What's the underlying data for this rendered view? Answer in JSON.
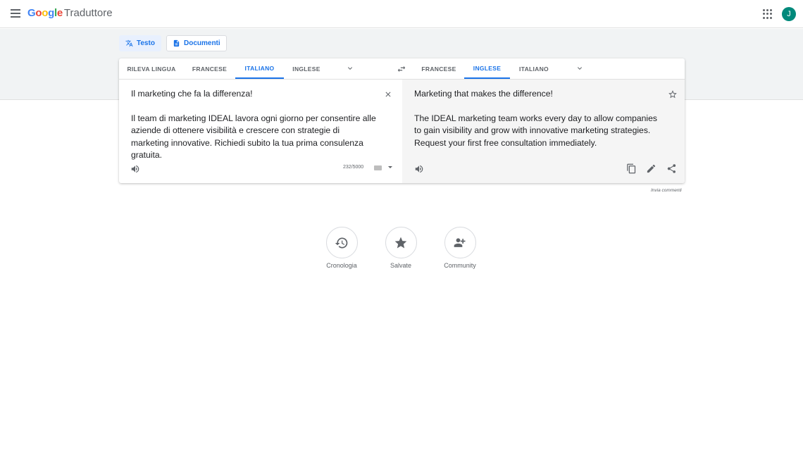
{
  "header": {
    "logo_text": "Google",
    "product_name": "Traduttore",
    "avatar_initial": "J",
    "icons": [
      "menu-icon",
      "apps-grid-icon"
    ]
  },
  "modes": [
    {
      "label": "Testo",
      "icon": "translate-icon",
      "active": true
    },
    {
      "label": "Documenti",
      "icon": "document-icon",
      "active": false
    }
  ],
  "source_languages": [
    "RILEVA LINGUA",
    "FRANCESE",
    "ITALIANO",
    "INGLESE"
  ],
  "source_active": "ITALIANO",
  "target_languages": [
    "FRANCESE",
    "INGLESE",
    "ITALIANO"
  ],
  "target_active": "INGLESE",
  "source": {
    "line1": "Il marketing che fa la differenza!",
    "line2": "Il team di marketing IDEAL lavora ogni giorno per consentire alle aziende di ottenere visibilità e crescere con strategie di marketing innovative. Richiedi subito la tua prima consulenza gratuita.",
    "char_count": "232/5000"
  },
  "target": {
    "line1": "Marketing that makes the difference!",
    "line2": "The IDEAL marketing team works every day to allow companies to gain visibility and grow with innovative marketing strategies. Request your first free consultation immediately."
  },
  "feedback_label": "Invia commenti",
  "quick_links": [
    {
      "label": "Cronologia",
      "icon": "history-icon"
    },
    {
      "label": "Salvate",
      "icon": "star-filled-icon"
    },
    {
      "label": "Community",
      "icon": "community-icon"
    }
  ],
  "colors": {
    "accent": "#1a73e8",
    "band": "#f1f3f4",
    "avatar": "#00897b"
  }
}
